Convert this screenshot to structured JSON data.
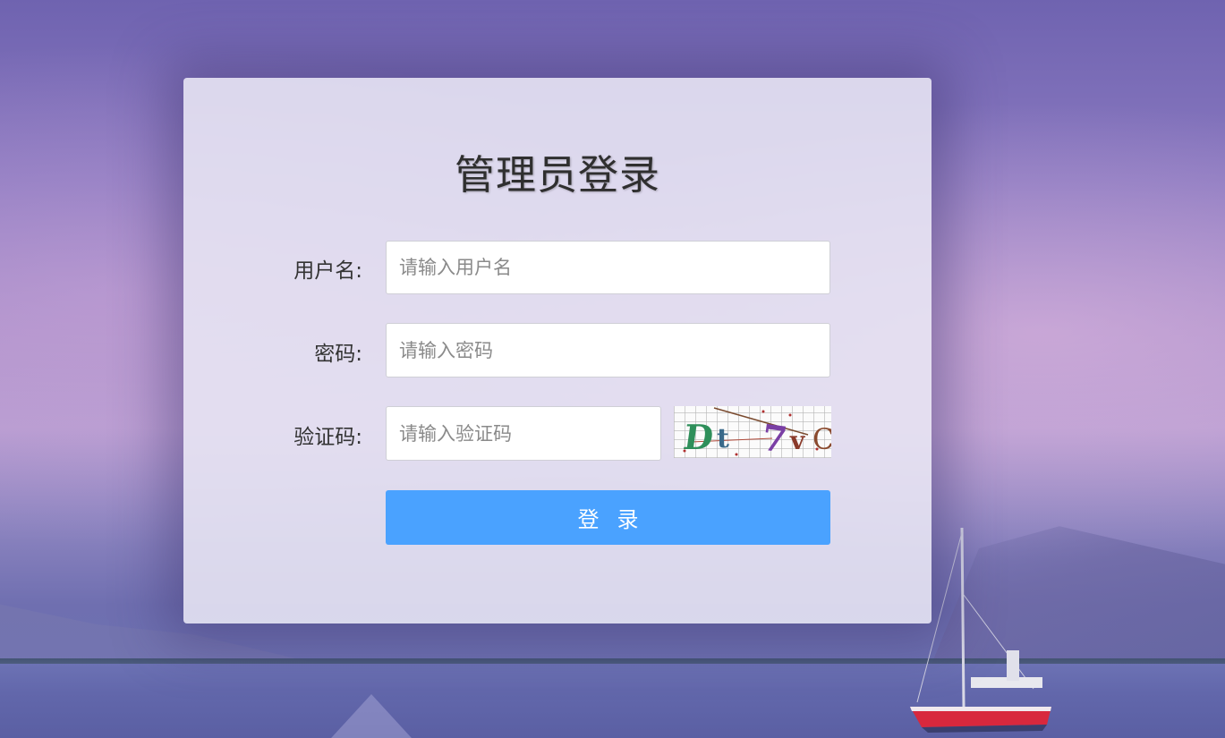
{
  "page": {
    "title": "管理员登录"
  },
  "form": {
    "username": {
      "label": "用户名:",
      "placeholder": "请输入用户名",
      "value": ""
    },
    "password": {
      "label": "密码:",
      "placeholder": "请输入密码",
      "value": ""
    },
    "captcha": {
      "label": "验证码:",
      "placeholder": "请输入验证码",
      "value": "",
      "image_text": "Dt7vC"
    },
    "submit_label": "登录"
  },
  "colors": {
    "button": "#4aa2ff",
    "card": "#e8e6f4",
    "title": "#2f2f2f"
  }
}
